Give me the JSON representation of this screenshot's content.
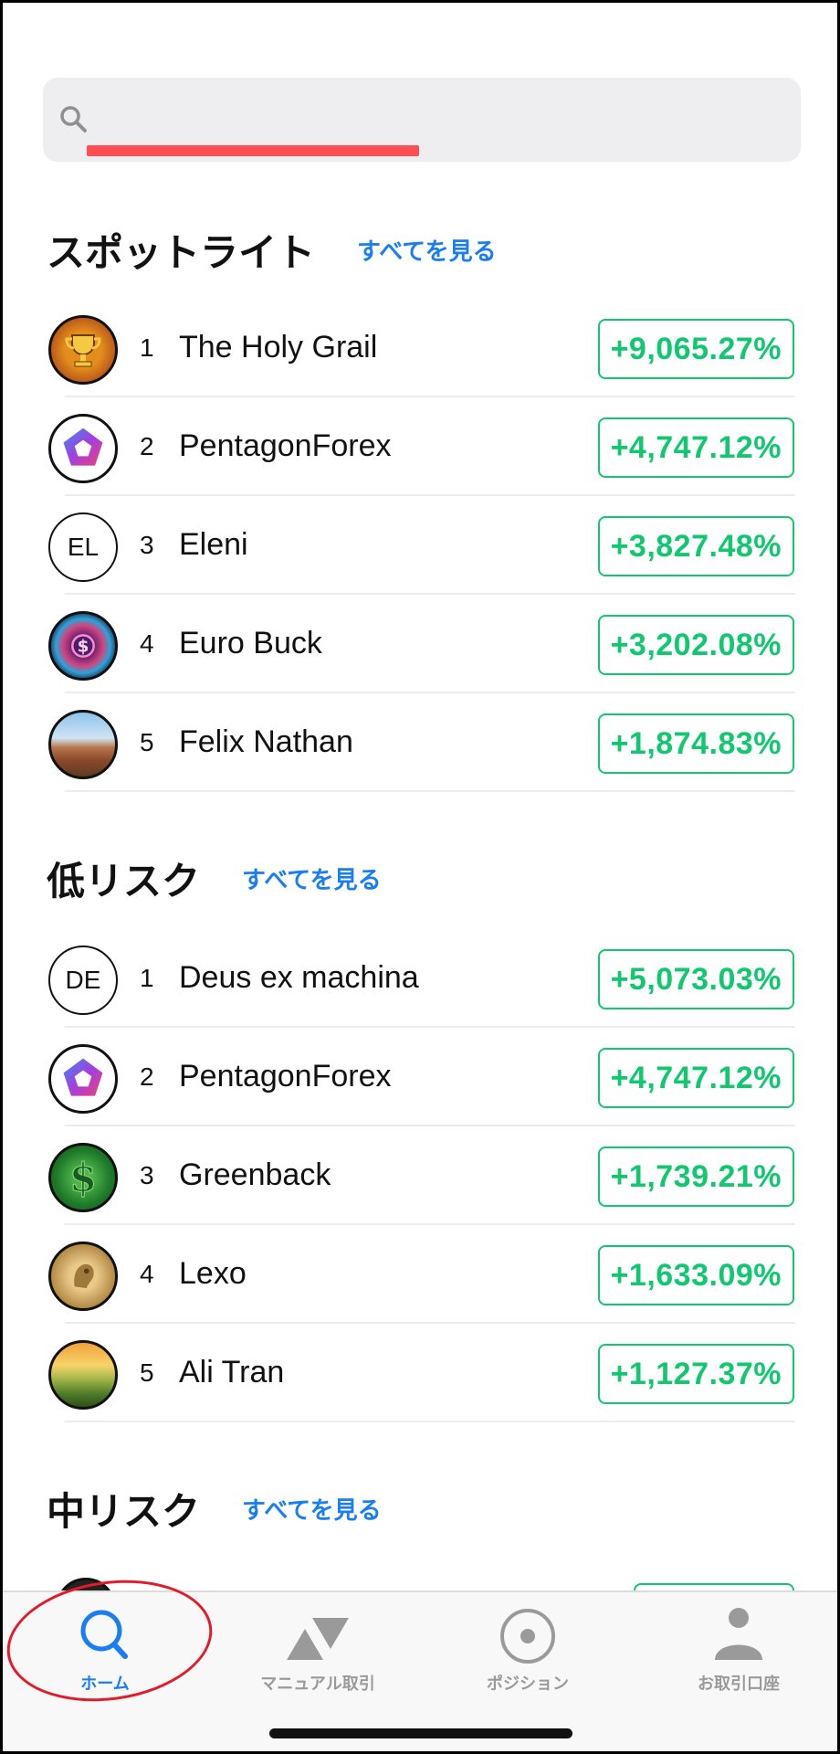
{
  "search": {
    "placeholder": ""
  },
  "colors": {
    "accent": "#1a7ef2",
    "gain": "#11c76f",
    "redacted_bar": "#ff4d52"
  },
  "sections": [
    {
      "title": "スポットライト",
      "see_all": "すべてを見る",
      "items": [
        {
          "rank": "1",
          "name": "The Holy Grail",
          "return": "+9,065.27%",
          "avatar": "trophy-avatar"
        },
        {
          "rank": "2",
          "name": "PentagonForex",
          "return": "+4,747.12%",
          "avatar": "pentagon-avatar"
        },
        {
          "rank": "3",
          "name": "Eleni",
          "return": "+3,827.48%",
          "avatar_text": "EL"
        },
        {
          "rank": "4",
          "name": "Euro Buck",
          "return": "+3,202.08%",
          "avatar": "neon-dollar-avatar"
        },
        {
          "rank": "5",
          "name": "Felix Nathan",
          "return": "+1,874.83%",
          "avatar": "desert-photo-avatar"
        }
      ]
    },
    {
      "title": "低リスク",
      "see_all": "すべてを見る",
      "items": [
        {
          "rank": "1",
          "name": "Deus ex machina",
          "return": "+5,073.03%",
          "avatar_text": "DE"
        },
        {
          "rank": "2",
          "name": "PentagonForex",
          "return": "+4,747.12%",
          "avatar": "pentagon-avatar"
        },
        {
          "rank": "3",
          "name": "Greenback",
          "return": "+1,739.21%",
          "avatar": "green-dollar-avatar"
        },
        {
          "rank": "4",
          "name": "Lexo",
          "return": "+1,633.09%",
          "avatar": "gold-coin-avatar"
        },
        {
          "rank": "5",
          "name": "Ali Tran",
          "return": "+1,127.37%",
          "avatar": "sunset-photo-avatar"
        }
      ]
    },
    {
      "title": "中リスク",
      "see_all": "すべてを見る",
      "items": []
    }
  ],
  "tabs": [
    {
      "label": "ホーム",
      "icon": "search-icon",
      "active": true
    },
    {
      "label": "マニュアル取引",
      "icon": "triangles-icon",
      "active": false
    },
    {
      "label": "ポジション",
      "icon": "target-circle-icon",
      "active": false
    },
    {
      "label": "お取引口座",
      "icon": "person-icon",
      "active": false
    }
  ]
}
